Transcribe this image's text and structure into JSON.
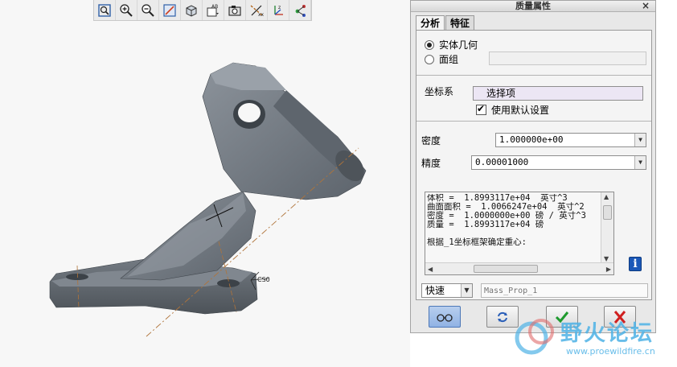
{
  "toolbar": {
    "buttons": [
      {
        "icon": "refit-icon"
      },
      {
        "icon": "zoom-in-icon"
      },
      {
        "icon": "zoom-out-icon"
      },
      {
        "icon": "repaint-icon"
      },
      {
        "icon": "display-style-icon"
      },
      {
        "icon": "saved-views-icon"
      },
      {
        "icon": "camera-icon"
      },
      {
        "icon": "datum-axis-icon"
      },
      {
        "icon": "datum-csys-icon"
      },
      {
        "icon": "spin-center-icon"
      }
    ]
  },
  "viewport": {
    "csys_label": "CS0"
  },
  "dialog": {
    "title": "质量属性",
    "close": "×",
    "tabs": [
      {
        "label": "分析",
        "active": true
      },
      {
        "label": "特征",
        "active": false
      }
    ],
    "geometry": {
      "solid_label": "实体几何",
      "solid_selected": true,
      "quilt_label": "面组",
      "quilt_selected": false
    },
    "csys": {
      "label": "坐标系",
      "pick_text": "选择项",
      "use_default_label": "使用默认设置",
      "use_default_checked": true
    },
    "density": {
      "label": "密度",
      "value": "1.000000e+00"
    },
    "accuracy": {
      "label": "精度",
      "value": "0.00001000"
    },
    "results": {
      "lines": [
        "体积 =  1.8993117e+04  英寸^3",
        "曲面面积 =  1.0066247e+04  英寸^2",
        "密度 =  1.0000000e+00 磅 / 英寸^3",
        "质量 =  1.8993117e+04 磅",
        "",
        "根据_1坐标框架确定重心:"
      ]
    },
    "mode": {
      "value": "快速"
    },
    "name": {
      "placeholder": "Mass_Prop_1"
    },
    "actions": [
      {
        "icon": "glasses-icon"
      },
      {
        "icon": "repeat-icon"
      },
      {
        "icon": "ok-check-icon"
      },
      {
        "icon": "cancel-x-icon"
      }
    ]
  },
  "watermark": {
    "title": "野火论坛",
    "url": "www.proewildfire.cn"
  },
  "colors": {
    "model": "#6b727a",
    "accent": "#1b58b8",
    "watermark": "#4eb2e6"
  }
}
